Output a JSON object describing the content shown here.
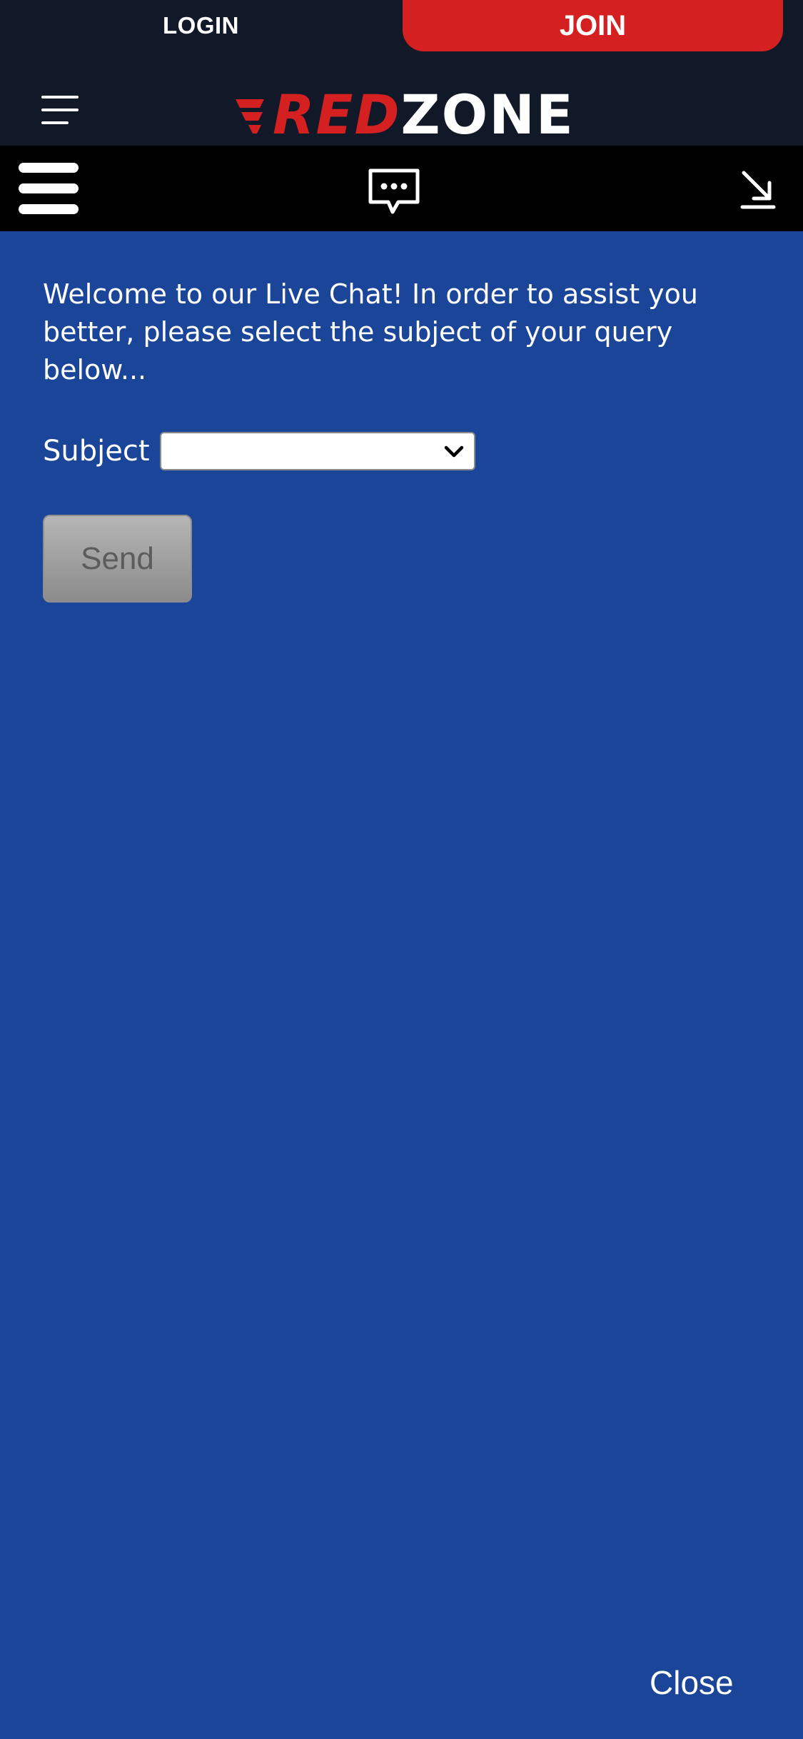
{
  "auth": {
    "login_label": "LOGIN",
    "join_label": "JOIN"
  },
  "header": {
    "logo_red": "RED",
    "logo_white": "ZONE"
  },
  "chat": {
    "welcome_message": "Welcome to our Live Chat! In order to assist you better, please select the subject of your query below...",
    "subject_label": "Subject",
    "subject_selected": "",
    "send_label": "Send",
    "close_label": "Close"
  },
  "icons": {
    "menu": "menu-icon",
    "chat_menu": "hamburger-icon",
    "chat_bubble": "chat-bubble-icon",
    "minimize": "minimize-arrow-icon",
    "dropdown": "chevron-down-icon"
  },
  "colors": {
    "brand_red": "#d42020",
    "header_bg": "#111827",
    "toolbar_bg": "#000000",
    "chat_bg": "#1b4598"
  }
}
